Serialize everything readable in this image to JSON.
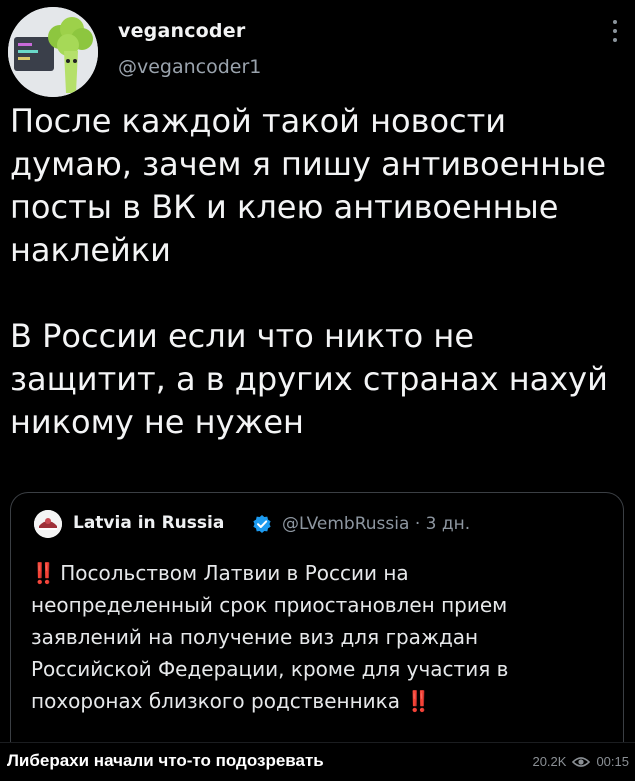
{
  "tweet": {
    "author_name": "vegancoder",
    "author_handle": "@vegancoder1",
    "more_icon": "more-vertical-icon",
    "text": "После каждой такой новости\nдумаю, зачем я пишу антивоенные\nпосты в ВК и клею антивоенные\nнаклейки\n\nВ России если что никто не\nзащитит, а в других странах нахуй\nникому не нужен"
  },
  "quote": {
    "author_name": "Latvia in Russia",
    "author_handle": "@LVembRussia",
    "separator": "·",
    "time": "3 дн.",
    "bang_start": "‼️",
    "text": "Посольством Латвии в России на\nнеопределенный срок приостановлен прием\nзаявлений на получение виз для граждан\nРоссийской Федерации, кроме для участия в\nпохоронах близкого родственника",
    "bang_end": "‼️"
  },
  "post": {
    "caption": "Либерахи начали что-то подозревать",
    "views": "20.2K",
    "time": "00:15"
  },
  "colors": {
    "background": "#000000",
    "verified": "#1d9bf0",
    "alert": "#e11d2b"
  }
}
